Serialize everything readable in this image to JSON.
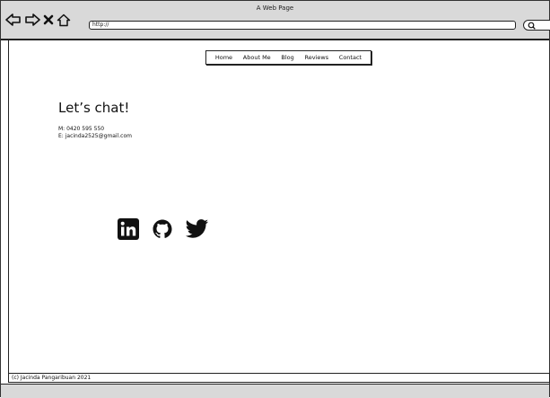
{
  "browser": {
    "window_title": "A Web Page",
    "address": "http://",
    "icons": [
      "back-arrow-icon",
      "forward-arrow-icon",
      "close-icon",
      "home-icon",
      "search-icon"
    ]
  },
  "nav": {
    "items": [
      {
        "label": "Home"
      },
      {
        "label": "About Me"
      },
      {
        "label": "Blog"
      },
      {
        "label": "Reviews"
      },
      {
        "label": "Contact"
      }
    ]
  },
  "main": {
    "heading": "Let’s chat!",
    "phone_line": "M: 0420 595 550",
    "email_line": "E: jacinda2525@gmail.com",
    "social_icons": [
      "linkedin-icon",
      "github-icon",
      "twitter-icon"
    ]
  },
  "footer": {
    "text": "(c) Jacinda Pangaribuan 2021"
  }
}
